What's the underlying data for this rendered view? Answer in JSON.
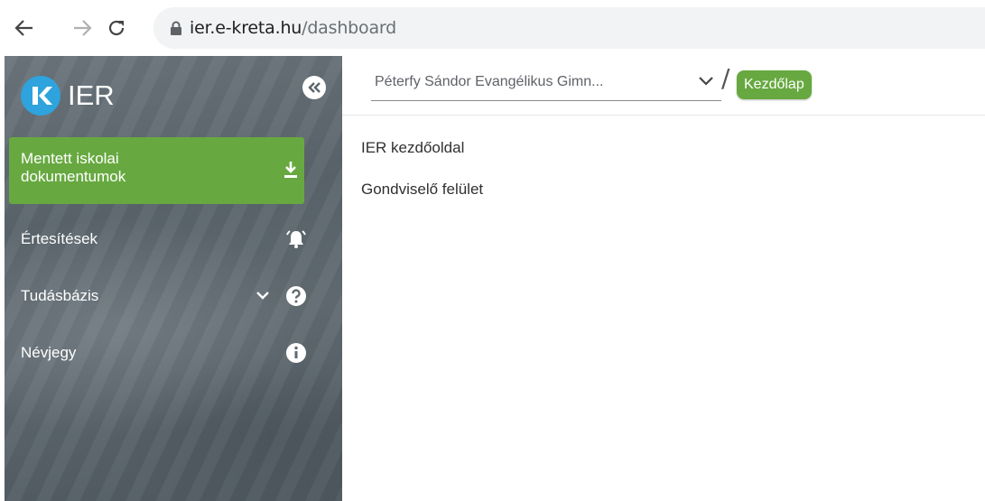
{
  "browser": {
    "url_host": "ier.e-kreta.hu",
    "url_path": "/dashboard"
  },
  "sidebar": {
    "logo_text": "IER",
    "logo_letter": "K",
    "items": [
      {
        "label_line1": "Mentett iskolai",
        "label_line2": "dokumentumok",
        "icon": "download-icon",
        "active": true
      },
      {
        "label": "Értesítések",
        "icon": "bell-icon"
      },
      {
        "label": "Tudásbázis",
        "icon": "help-icon"
      },
      {
        "label": "Névjegy",
        "icon": "info-icon"
      }
    ]
  },
  "header": {
    "school_select_value": "Péterfy Sándor Evangélikus Gimn...",
    "breadcrumb_separator": "/",
    "breadcrumb_current": "Kezdőlap"
  },
  "main": {
    "links": [
      "IER kezdőoldal",
      "Gondviselő felület"
    ]
  },
  "colors": {
    "accent_green": "#67a940",
    "logo_blue": "#2ea3dd",
    "sidebar_gray": "#5f696f"
  }
}
